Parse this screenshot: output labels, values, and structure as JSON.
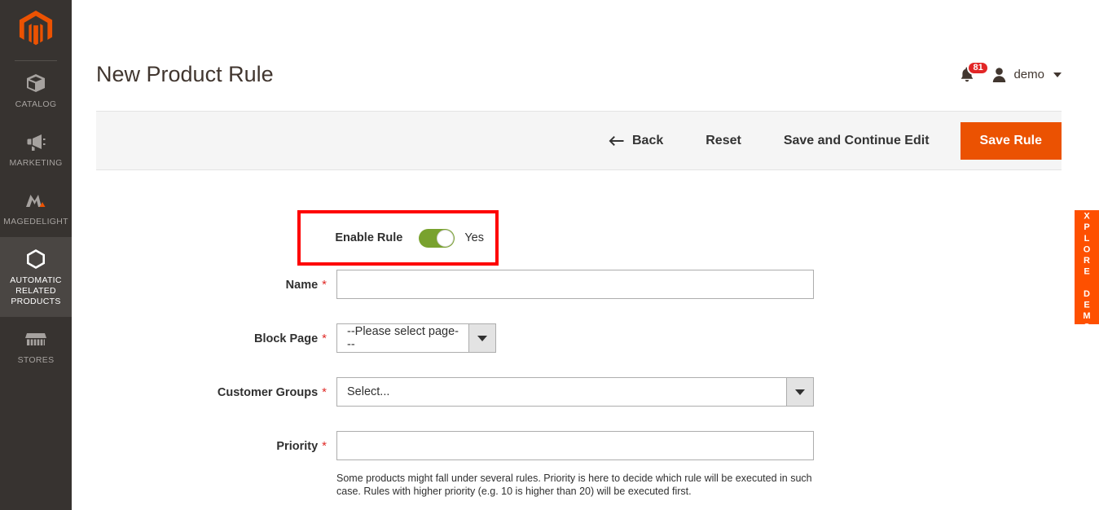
{
  "sidebar": {
    "logo_name": "magento-logo",
    "items": [
      {
        "label": "Catalog",
        "icon": "box-icon",
        "active": false
      },
      {
        "label": "Marketing",
        "icon": "megaphone-icon",
        "active": false
      },
      {
        "label": "MageDelight",
        "icon": "magedelight-icon",
        "active": false
      },
      {
        "label": "Automatic Related Products",
        "icon": "hexagon-icon",
        "active": true
      },
      {
        "label": "Stores",
        "icon": "storefront-icon",
        "active": false
      }
    ]
  },
  "header": {
    "title": "New Product Rule",
    "notifications": {
      "icon": "bell-icon",
      "count": "81"
    },
    "user": {
      "icon": "user-icon",
      "name": "demo",
      "caret": "chevron-down-icon"
    }
  },
  "toolbar": {
    "back_label": "Back",
    "back_icon": "arrow-left-icon",
    "reset_label": "Reset",
    "save_continue_label": "Save and Continue Edit",
    "save_label": "Save Rule",
    "primary_color": "#eb5202"
  },
  "form": {
    "enable_rule": {
      "label": "Enable Rule",
      "state_text": "Yes",
      "checked": true,
      "track_color": "#79a22e",
      "highlight_color": "#fe0000"
    },
    "name": {
      "label": "Name",
      "required": "*",
      "value": "",
      "placeholder": ""
    },
    "block_page": {
      "label": "Block Page",
      "required": "*",
      "selected": "--Please select page---",
      "arrow_icon": "caret-down-icon"
    },
    "customer_groups": {
      "label": "Customer Groups",
      "required": "*",
      "selected": "Select...",
      "arrow_icon": "caret-down-icon"
    },
    "priority": {
      "label": "Priority",
      "required": "*",
      "value": "",
      "placeholder": "",
      "note": "Some products might fall under several rules. Priority is here to decide which rule will be executed in such case. Rules with higher priority (e.g. 10 is higher than 20) will be executed first."
    }
  },
  "explore_demo": {
    "label": "EXPLORE DEMO",
    "color": "#fe5000"
  }
}
